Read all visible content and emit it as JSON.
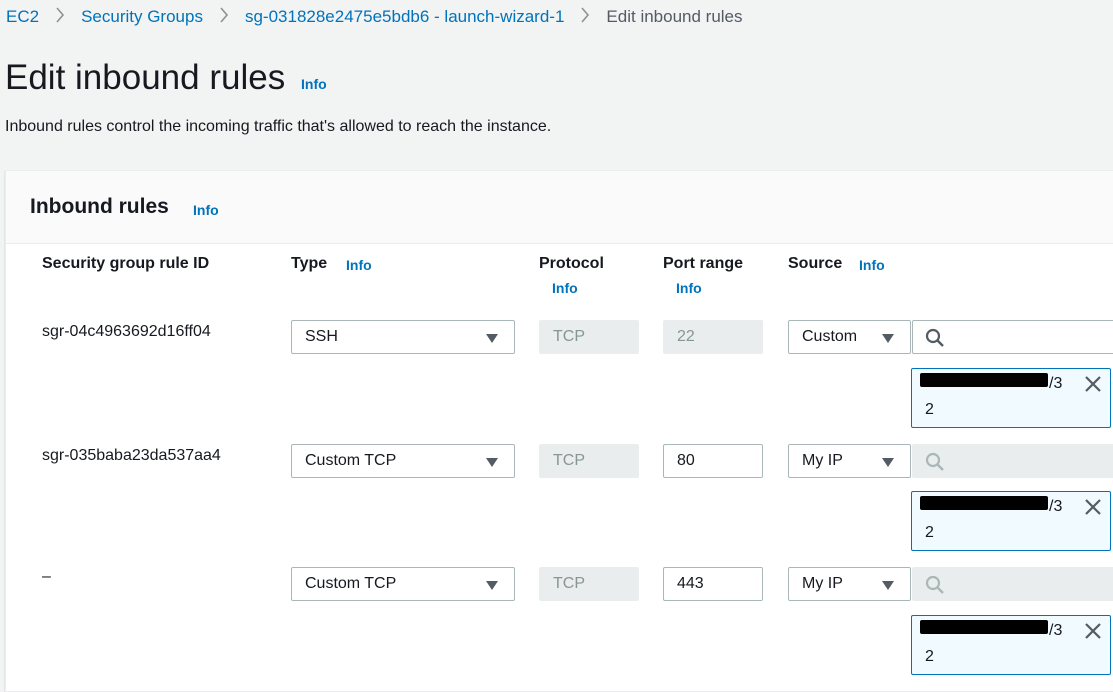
{
  "breadcrumb": {
    "items": [
      "EC2",
      "Security Groups",
      "sg-031828e2475e5bdb6 - launch-wizard-1",
      "Edit inbound rules"
    ]
  },
  "page": {
    "title": "Edit inbound rules",
    "info": "Info",
    "description": "Inbound rules control the incoming traffic that's allowed to reach the instance."
  },
  "panel": {
    "title": "Inbound rules",
    "info": "Info"
  },
  "columns": {
    "rule_id": "Security group rule ID",
    "type": "Type",
    "type_info": "Info",
    "protocol": "Protocol",
    "protocol_info": "Info",
    "port_range": "Port range",
    "port_range_info": "Info",
    "source": "Source",
    "source_info": "Info"
  },
  "rules": [
    {
      "id": "sgr-04c4963692d16ff04",
      "type": "SSH",
      "protocol": "TCP",
      "port": "22",
      "source": "Custom",
      "token_suffix": "/3",
      "token_line2": "2"
    },
    {
      "id": "sgr-035baba23da537aa4",
      "type": "Custom TCP",
      "protocol": "TCP",
      "port": "80",
      "source": "My IP",
      "token_suffix": "/3",
      "token_line2": "2"
    },
    {
      "id": "–",
      "type": "Custom TCP",
      "protocol": "TCP",
      "port": "443",
      "source": "My IP",
      "token_suffix": "/3",
      "token_line2": "2"
    }
  ],
  "icons": {
    "search": "search-icon",
    "close": "close-icon",
    "chevron": "chevron-right-icon",
    "caret": "caret-down-icon"
  },
  "colors": {
    "link": "#0073bb",
    "token_bg": "#f1faff",
    "disabled_bg": "#eaeded"
  }
}
